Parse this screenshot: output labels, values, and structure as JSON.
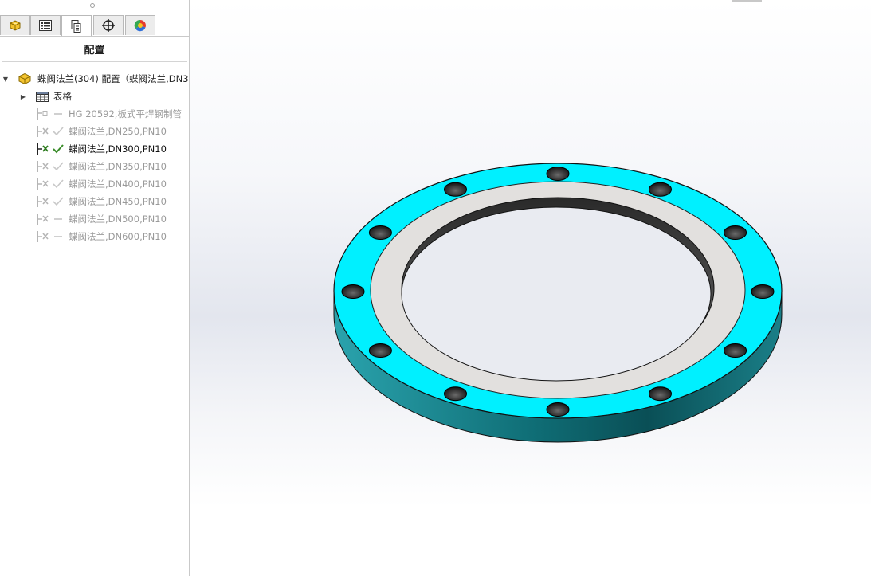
{
  "panel": {
    "title": "配置",
    "tabs": [
      {
        "name": "feature-manager",
        "icon": "part-icon"
      },
      {
        "name": "property-manager",
        "icon": "property-list-icon"
      },
      {
        "name": "configuration-manager",
        "icon": "configuration-icon"
      },
      {
        "name": "dimxpert-manager",
        "icon": "crosshair-icon"
      },
      {
        "name": "display-manager",
        "icon": "appearance-pie-icon"
      }
    ],
    "tree": {
      "root_label": "蝶阀法兰(304) 配置（蝶阀法兰,DN3",
      "table_label": "表格",
      "configs": [
        {
          "label": "HG 20592,板式平焊钢制管",
          "state": "dim",
          "check": "dash"
        },
        {
          "label": "蝶阀法兰,DN250,PN10",
          "state": "dim",
          "check": "check"
        },
        {
          "label": "蝶阀法兰,DN300,PN10",
          "state": "active",
          "check": "check"
        },
        {
          "label": "蝶阀法兰,DN350,PN10",
          "state": "dim",
          "check": "check"
        },
        {
          "label": "蝶阀法兰,DN400,PN10",
          "state": "dim",
          "check": "check"
        },
        {
          "label": "蝶阀法兰,DN450,PN10",
          "state": "dim",
          "check": "check"
        },
        {
          "label": "蝶阀法兰,DN500,PN10",
          "state": "dim",
          "check": "dash"
        },
        {
          "label": "蝶阀法兰,DN600,PN10",
          "state": "dim",
          "check": "dash"
        }
      ]
    }
  },
  "viewport": {
    "model": "flange-ring",
    "bolt_holes": 12,
    "colors": {
      "flange_face": "#00f0ff",
      "flange_side": "#1a7f88",
      "gasket_face": "#e2e0de",
      "bore_wall": "#3a3a3a",
      "check_active": "#3a8c2a",
      "check_dim": "#c0c0c0"
    }
  }
}
